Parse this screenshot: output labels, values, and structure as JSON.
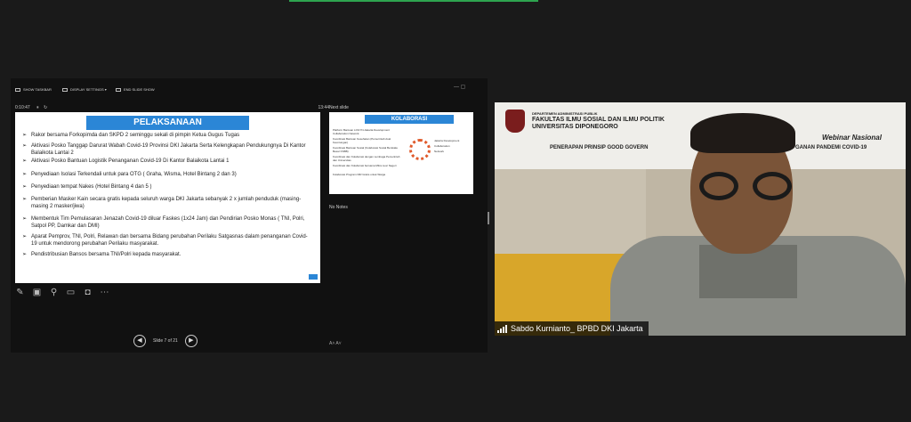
{
  "toolbar": {
    "show_taskbar": "SHOW TASKBAR",
    "display_settings": "DISPLAY SETTINGS ▾",
    "end_slide_show": "END SLIDE SHOW",
    "win_controls": "—  ▢"
  },
  "presenter": {
    "elapsed": "0:10:47",
    "clock": "13:44",
    "slide_title": "PELAKSANAAN",
    "bullets": [
      "Rakor bersama Forkopimda dan SKPD 2 seminggu sekali di pimpin Ketua Gugus Tugas",
      "Aktivasi Posko Tanggap Darurat Wabah Covid-19 Provinsi DKI Jakarta Serta Kelengkapan Pendukungnya Di Kantor  Balaikota Lantai 2",
      "Aktivasi Posko Bantuan Logistik Penanganan Covid-19 Di Kantor Balaikota Lantai 1",
      "Penyediaan Isolasi Terkendali untuk para OTG ( Graha, Wisma, Hotel Bintang 2 dan 3)",
      "Penyediaan  tempat Nakes (Hotel Bintang 4 dan 5 )",
      "Pemberian Masker Kain secara gratis kepada seluruh warga DKI Jakarta sebanyak 2 x jumlah penduduk (masing-masing 2 masker/jiwa)",
      "Membentuk Tim Pemulasaran Jenazah Covid-19 diluar Faskes (1x24 Jam) dan Pendirian Posko Monas ( TNI, Polri, Satpol PP, Damkar dan DMI)",
      "Aparat Pemprov, TNI, Polri, Relawan dan bersama Bidang perubahan Perilaku Satgasnas dalam penanganan Covid-19 untuk mendorong perubahan Perilaku masyarakat.",
      "Pendistribusian Bansos bersama TNI/Polri kepada masyarakat."
    ],
    "slide_counter": "Slide 7 of 21",
    "next_slide_label": "Next slide",
    "next_title": "KOLABORASI",
    "next_bullets": [
      "Platform       Bantuan       LOGYN-Jakarta Development Collaboration Network",
      "Koordinasi Bantuan Kesehatan (Pemerintah Asal Keuntungan)",
      "Koordinasi Bantuan Sosial (Kolaborasi Sosial Berskala Besar KSBB)",
      "Koordinasi dan Kolaborasi dengan Lembaga Pemerintah dan Universitas",
      "Koordinasi dan Kolaborasi bersama Mitra Luar Negeri",
      "Kolaborasi Program NIR Gratis untuk Warga"
    ],
    "sdg_text": [
      "Jakarta Development",
      "Collaboration",
      "Network"
    ],
    "notes_label": "No Notes"
  },
  "camera": {
    "banner_dept": "DEPARTEMEN ADMINISTRASI PUBLIK",
    "banner_faculty": "FAKULTAS ILMU SOSIAL DAN ILMU POLITIK",
    "banner_univ": "UNIVERSITAS DIPONEGORO",
    "banner_event": "Webinar Nasional",
    "banner_topic_left": "PENERAPAN PRINSIP GOOD GOVERN",
    "banner_topic_right": "GANAN PANDEMI COVID-19",
    "participant_name": "Sabdo Kurnianto_ BPBD DKI Jakarta"
  }
}
